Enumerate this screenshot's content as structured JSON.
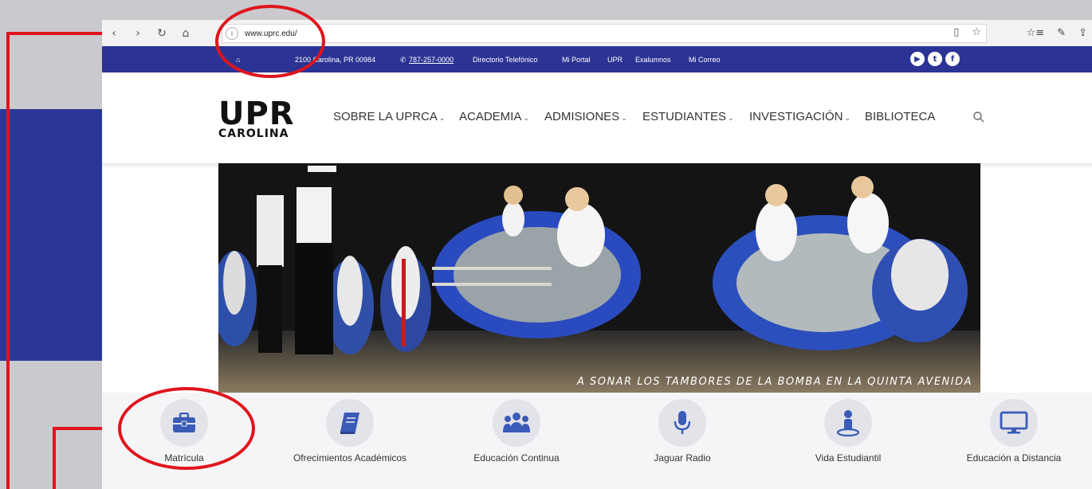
{
  "browser": {
    "url": "www.uprc.edu/",
    "nav": {
      "back": "‹",
      "forward": "›",
      "refresh": "↻",
      "home": "⌂"
    }
  },
  "infobar": {
    "address": "2100 Carolina, PR 00984",
    "phone": "787-257-0000",
    "links": [
      "Directorio Telefónico",
      "Mi Portal",
      "UPR",
      "Exalumnos",
      "Mi Correo"
    ],
    "social_icons": [
      "youtube-icon",
      "twitter-icon",
      "facebook-icon"
    ]
  },
  "header": {
    "logo_line1": "UPR",
    "logo_line2": "CAROLINA",
    "menu": [
      {
        "label": "SOBRE LA UPRCA",
        "caret": "⌄"
      },
      {
        "label": "ACADEMIA",
        "caret": "⌄"
      },
      {
        "label": "ADMISIONES",
        "caret": "⌄"
      },
      {
        "label": "ESTUDIANTES",
        "caret": "⌄"
      },
      {
        "label": "INVESTIGACIÓN",
        "caret": "⌄"
      },
      {
        "label": "BIBLIOTECA",
        "caret": ""
      }
    ]
  },
  "hero": {
    "caption": "A SONAR LOS TAMBORES DE LA BOMBA EN LA QUINTA AVENIDA"
  },
  "quick_links": [
    {
      "label": "Matrícula",
      "icon": "briefcase-icon"
    },
    {
      "label": "Ofrecimientos Académicos",
      "icon": "book-icon"
    },
    {
      "label": "Educación Continua",
      "icon": "users-icon"
    },
    {
      "label": "Jaguar Radio",
      "icon": "microphone-icon"
    },
    {
      "label": "Vida Estudiantil",
      "icon": "student-icon"
    },
    {
      "label": "Educación a Distancia",
      "icon": "monitor-icon"
    }
  ],
  "colors": {
    "brand_blue": "#2b3494",
    "icon_blue": "#3a5bb8",
    "annotation_red": "#e0141c"
  }
}
